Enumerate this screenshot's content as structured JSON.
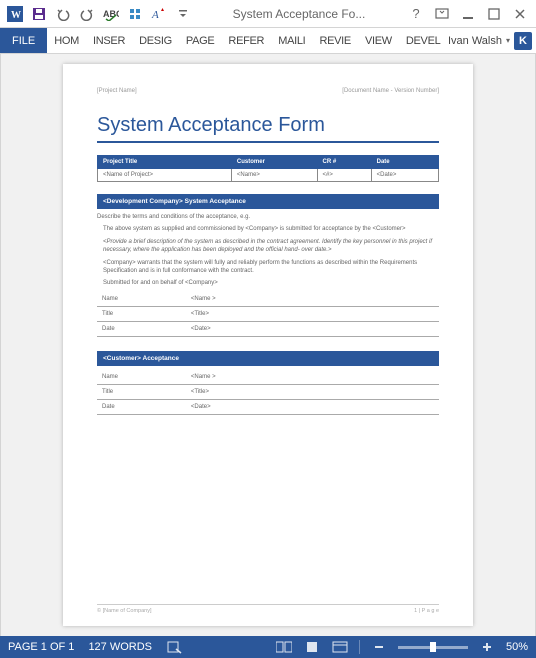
{
  "titlebar": {
    "title": "System Acceptance Fo..."
  },
  "ribbon": {
    "file": "FILE",
    "tabs": [
      "HOM",
      "INSER",
      "DESIG",
      "PAGE",
      "REFER",
      "MAILI",
      "REVIE",
      "VIEW",
      "DEVEL"
    ]
  },
  "user": {
    "name": "Ivan Walsh",
    "initial": "K"
  },
  "doc": {
    "header_left": "[Project Name]",
    "header_right": "[Document Name - Version Number]",
    "title": "System Acceptance Form",
    "info_headers": [
      "Project Title",
      "Customer",
      "CR #",
      "Date"
    ],
    "info_values": [
      "<Name of Project>",
      "<Name>",
      "<#>",
      "<Date>"
    ],
    "section1_title": "<Development Company> System Acceptance",
    "desc1": "Describe the terms and conditions of the acceptance, e.g.",
    "desc2": "The above system as supplied and commissioned by <Company> is submitted for acceptance by the <Customer>",
    "desc3": "<Provide a brief description of the system as described in the contract agreement. Identify the key personnel in this project if necessary, where the application has been deployed and the official hand- over date.>",
    "desc4": "<Company> warrants that the system will fully and reliably perform the functions as described within the Requirements Specification and is in full conformance with the contract.",
    "desc5": "Submitted for and on behalf of <Company>",
    "sig1": [
      [
        "Name",
        "<Name >"
      ],
      [
        "Title",
        "<Title>"
      ],
      [
        "Date",
        "<Date>"
      ]
    ],
    "section2_title": "<Customer> Acceptance",
    "sig2": [
      [
        "Name",
        "<Name >"
      ],
      [
        "Title",
        "<Title>"
      ],
      [
        "Date",
        "<Date>"
      ]
    ],
    "footer_left": "© [Name of Company]",
    "footer_right": "1 | P a g e"
  },
  "statusbar": {
    "page": "PAGE 1 OF 1",
    "words": "127 WORDS",
    "zoom": "50%"
  }
}
